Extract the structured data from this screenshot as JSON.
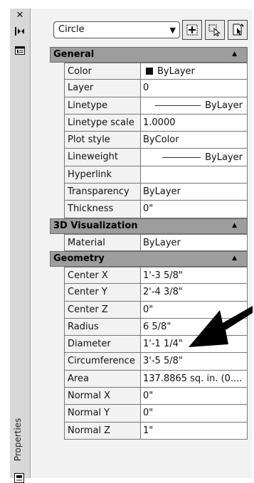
{
  "window": {
    "title": "Properties"
  },
  "object_type": {
    "selected": "Circle"
  },
  "sections": [
    {
      "title": "General",
      "rows": [
        {
          "name": "Color",
          "value": "ByLayer",
          "kind": "color",
          "swatch": "#111111"
        },
        {
          "name": "Layer",
          "value": "0",
          "kind": "text"
        },
        {
          "name": "Linetype",
          "value": "ByLayer",
          "kind": "line"
        },
        {
          "name": "Linetype scale",
          "value": "1.0000",
          "kind": "text"
        },
        {
          "name": "Plot style",
          "value": "ByColor",
          "kind": "text"
        },
        {
          "name": "Lineweight",
          "value": "ByLayer",
          "kind": "line"
        },
        {
          "name": "Hyperlink",
          "value": "",
          "kind": "text"
        },
        {
          "name": "Transparency",
          "value": "ByLayer",
          "kind": "text"
        },
        {
          "name": "Thickness",
          "value": "0\"",
          "kind": "text"
        }
      ]
    },
    {
      "title": "3D Visualization",
      "rows": [
        {
          "name": "Material",
          "value": "ByLayer",
          "kind": "text"
        }
      ]
    },
    {
      "title": "Geometry",
      "rows": [
        {
          "name": "Center X",
          "value": "1'-3 5/8\"",
          "kind": "text"
        },
        {
          "name": "Center Y",
          "value": "2'-4 3/8\"",
          "kind": "text"
        },
        {
          "name": "Center Z",
          "value": "0\"",
          "kind": "text"
        },
        {
          "name": "Radius",
          "value": "6 5/8\"",
          "kind": "text"
        },
        {
          "name": "Diameter",
          "value": "1'-1 1/4\"",
          "kind": "text"
        },
        {
          "name": "Circumference",
          "value": "3'-5 5/8\"",
          "kind": "text"
        },
        {
          "name": "Area",
          "value": "137.8865 sq. in. (0....",
          "kind": "text"
        },
        {
          "name": "Normal X",
          "value": "0\"",
          "kind": "text"
        },
        {
          "name": "Normal Y",
          "value": "0\"",
          "kind": "text"
        },
        {
          "name": "Normal Z",
          "value": "1\"",
          "kind": "text"
        }
      ]
    }
  ],
  "icons": {
    "close": "close-icon",
    "autohide": "auto-hide-icon",
    "properties_menu": "properties-menu-icon",
    "pickadd": "toggle-pickadd-icon",
    "select_objects": "select-objects-icon",
    "quick_select": "quick-select-icon",
    "collapse": "collapse-up-icon"
  },
  "colors": {
    "section_header": "#9d9d9d",
    "panel_bg": "#f2f2f2"
  }
}
